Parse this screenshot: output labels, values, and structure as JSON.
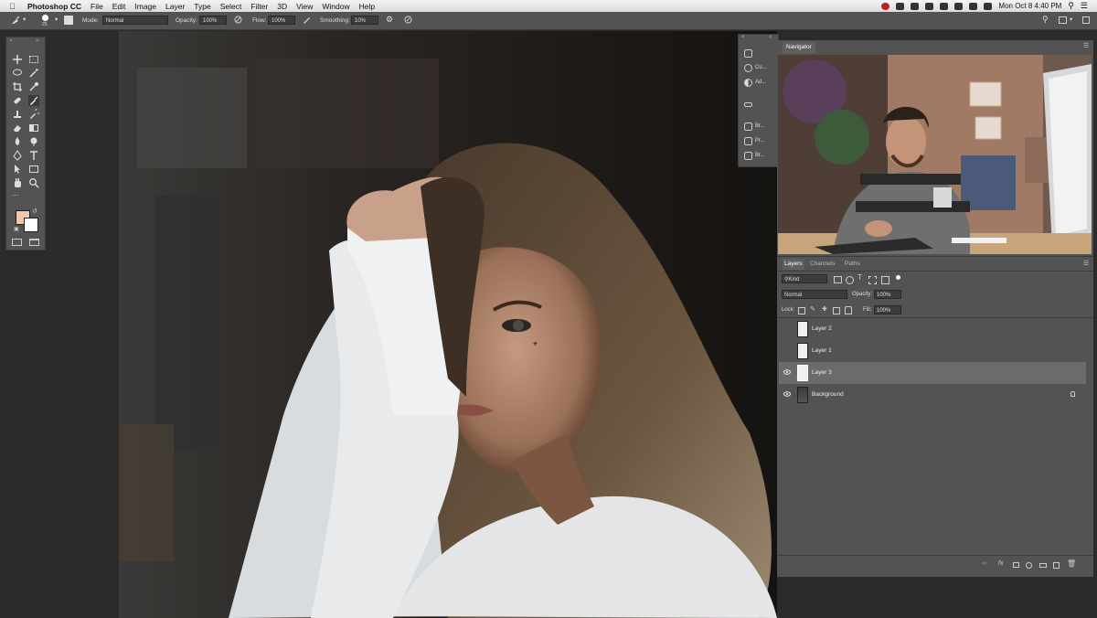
{
  "menubar": {
    "app_name": "Photoshop CC",
    "items": [
      "File",
      "Edit",
      "Image",
      "Layer",
      "Type",
      "Select",
      "Filter",
      "3D",
      "View",
      "Window",
      "Help"
    ],
    "clock": "Mon Oct 8  4:40 PM"
  },
  "options_bar": {
    "brush_size": "25",
    "mode_label": "Mode:",
    "mode_value": "Normal",
    "opacity_label": "Opacity:",
    "opacity_value": "100%",
    "flow_label": "Flow:",
    "flow_value": "100%",
    "smoothing_label": "Smoothing:",
    "smoothing_value": "10%"
  },
  "colors": {
    "foreground": "#f2c7ad",
    "background": "#ffffff",
    "panel_bg": "#535353",
    "selected_row": "#6b6b6b"
  },
  "strip_panels": [
    {
      "icon": "history-icon",
      "label": ""
    },
    {
      "icon": "color-icon",
      "label": "Co..."
    },
    {
      "icon": "adjustments-icon",
      "label": "Ad..."
    },
    {
      "icon": "ruler-icon",
      "label": ""
    },
    {
      "icon": "brush-settings-icon",
      "label": "Br..."
    },
    {
      "icon": "properties-icon",
      "label": "Pr..."
    },
    {
      "icon": "brushes-icon",
      "label": "Br..."
    }
  ],
  "navigator": {
    "tab": "Navigator"
  },
  "layers_panel": {
    "tabs": [
      "Layers",
      "Channels",
      "Paths"
    ],
    "filter_kind": "Kind",
    "blend_mode": "Normal",
    "opacity_label": "Opacity:",
    "opacity_value": "100%",
    "lock_label": "Lock:",
    "fill_label": "Fill:",
    "fill_value": "100%",
    "layers": [
      {
        "name": "Layer 2",
        "visible": false,
        "selected": false,
        "thumb": "white"
      },
      {
        "name": "Layer 1",
        "visible": false,
        "selected": false,
        "thumb": "white"
      },
      {
        "name": "Layer 3",
        "visible": true,
        "selected": true,
        "thumb": "white"
      },
      {
        "name": "Background",
        "visible": true,
        "selected": false,
        "thumb": "photo",
        "locked": true
      }
    ]
  }
}
